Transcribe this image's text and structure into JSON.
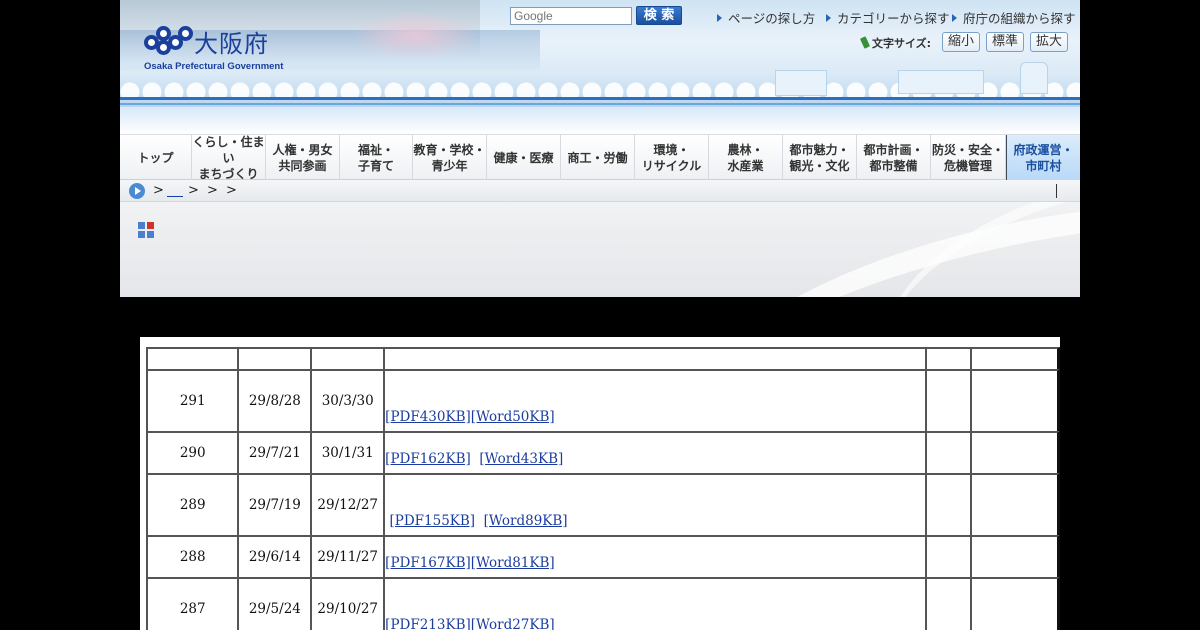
{
  "header": {
    "logo_name": "大阪府",
    "logo_en": "Osaka Prefectural Government",
    "search_placeholder": "Google",
    "search_button": "検 索",
    "links": [
      "ページの探し方",
      "カテゴリーから探す",
      "府庁の組織から探す"
    ],
    "font_size_label": "文字サイズ:",
    "font_size_buttons": [
      "縮小",
      "標準",
      "拡大"
    ]
  },
  "nav": {
    "items": [
      "トップ",
      "くらし・住まい\nまちづくり",
      "人権・男女\n共同参画",
      "福祉・\n子育て",
      "教育・学校・\n青少年",
      "健康・医療",
      "商工・労働",
      "環境・\nリサイクル",
      "農林・\n水産業",
      "都市魅力・\n観光・文化",
      "都市計画・\n都市整備",
      "防災・安全・\n危機管理",
      "府政運営・\n市町村"
    ],
    "active_index": 12
  },
  "breadcrumb": {
    "separators": [
      ">",
      ">",
      ">",
      ">"
    ]
  },
  "table": {
    "rows": [
      {
        "no": "291",
        "date1": "29/8/28",
        "date2": "30/3/30",
        "pdf": "[PDF430KB]",
        "word": "[Word50KB]",
        "spacing": "none"
      },
      {
        "no": "290",
        "date1": "29/7/21",
        "date2": "30/1/31",
        "pdf": "[PDF162KB]",
        "word": "[Word43KB]",
        "spacing": "gap"
      },
      {
        "no": "289",
        "date1": "29/7/19",
        "date2": "29/12/27",
        "pdf": "[PDF155KB]",
        "word": "[Word89KB]",
        "spacing": "lead"
      },
      {
        "no": "288",
        "date1": "29/6/14",
        "date2": "29/11/27",
        "pdf": "[PDF167KB]",
        "word": "[Word81KB]",
        "spacing": "none"
      },
      {
        "no": "287",
        "date1": "29/5/24",
        "date2": "29/10/27",
        "pdf": "[PDF213KB]",
        "word": "[Word27KB]",
        "spacing": "none"
      }
    ]
  },
  "colors": {
    "brand_blue": "#1a3f9c",
    "link": "#1a3c9e",
    "nav_active_bg": "#b9d9f7"
  }
}
